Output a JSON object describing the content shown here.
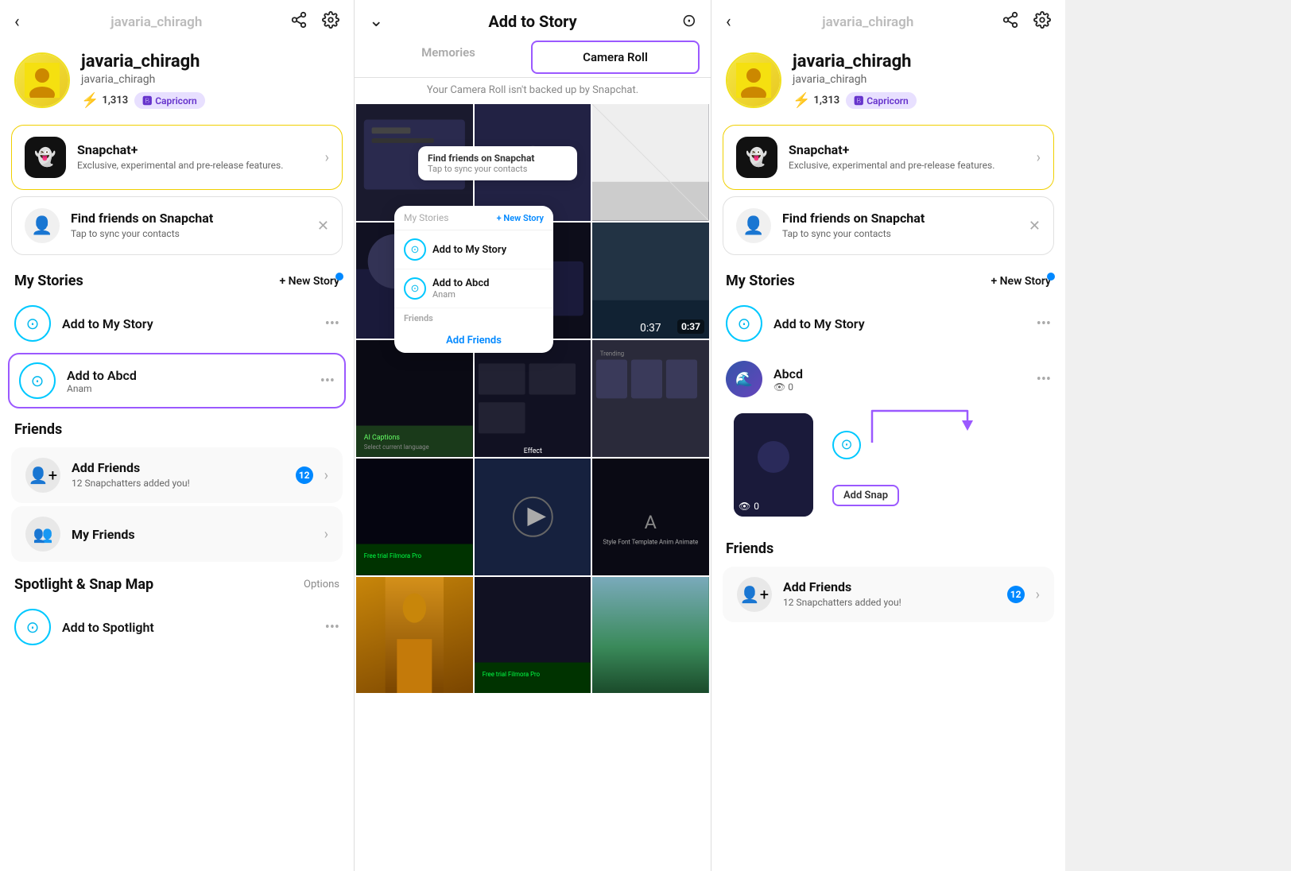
{
  "left_panel": {
    "header": {
      "back_label": "‹",
      "username": "javaria_chiragh",
      "share_icon": "share",
      "settings_icon": "settings"
    },
    "profile": {
      "name": "javaria_chiragh",
      "handle": "javaria_chiragh",
      "score": "1,313",
      "zodiac": "Capricorn"
    },
    "snapchat_plus": {
      "title": "Snapchat+",
      "subtitle": "Exclusive, experimental and pre-release features."
    },
    "find_friends": {
      "title": "Find friends on Snapchat",
      "subtitle": "Tap to sync your contacts"
    },
    "my_stories_label": "My Stories",
    "new_story_label": "+ New Story",
    "add_my_story_label": "Add to My Story",
    "add_abcd_label": "Add to Abcd",
    "add_abcd_sub": "Anam",
    "friends_label": "Friends",
    "add_friends_label": "Add Friends",
    "add_friends_sub": "12 Snapchatters added you!",
    "add_friends_count": "12",
    "my_friends_label": "My Friends",
    "spotlight_label": "Spotlight & Snap Map",
    "options_label": "Options",
    "add_spotlight_label": "Add to Spotlight"
  },
  "middle_panel": {
    "header": {
      "chevron": "›",
      "title": "Add to Story",
      "camera_icon": "camera"
    },
    "tabs": [
      {
        "label": "Memories",
        "active": false
      },
      {
        "label": "Camera Roll",
        "active": true
      }
    ],
    "warning": "Your Camera Roll isn't backed up by Snapchat.",
    "popup": {
      "my_stories_label": "My Stories",
      "new_story_label": "+ New Story",
      "add_my_story": "Add to My Story",
      "add_abcd": "Add to Abcd",
      "add_abcd_sub": "Anam",
      "friends_label": "Friends",
      "add_friends": "Add Friends"
    },
    "find_friends_popup": {
      "text": "Find friends on Snapchat",
      "sub": "Tap to sync your contacts"
    }
  },
  "right_panel": {
    "header": {
      "back_label": "‹",
      "username": "javaria_chiragh",
      "share_icon": "share",
      "settings_icon": "settings"
    },
    "profile": {
      "name": "javaria_chiragh",
      "handle": "javaria_chiragh",
      "score": "1,313",
      "zodiac": "Capricorn"
    },
    "snapchat_plus": {
      "title": "Snapchat+",
      "subtitle": "Exclusive, experimental and pre-release features."
    },
    "find_friends": {
      "title": "Find friends on Snapchat",
      "subtitle": "Tap to sync your contacts"
    },
    "my_stories_label": "My Stories",
    "new_story_label": "+ New Story",
    "add_my_story_label": "Add to My Story",
    "abcd_label": "Abcd",
    "abcd_views": "0",
    "add_snap_label": "Add Snap",
    "friends_label": "Friends",
    "add_friends_label": "Add Friends",
    "add_friends_sub": "12 Snapchatters added you!",
    "add_friends_count": "12"
  }
}
